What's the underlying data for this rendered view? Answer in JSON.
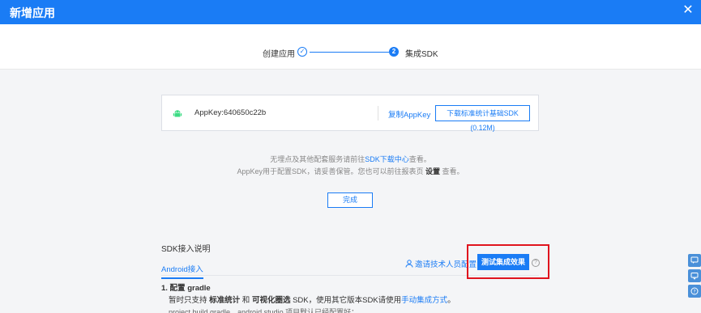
{
  "header": {
    "title": "新增应用",
    "close": "✕"
  },
  "steps": {
    "step1_label": "创建应用",
    "step1_mark": "✓",
    "step2_num": "2",
    "step2_label": "集成SDK"
  },
  "keybox": {
    "appkey": "AppKey:640650c22b",
    "copy_label": "复制AppKey",
    "download_label": "下载标准统计基础SDK (0.12M)"
  },
  "info": {
    "line1_pre": "无埋点及其他配套服务请前往",
    "line1_link": "SDK下载中心",
    "line1_post": "查看。",
    "line2_pre": "AppKey用于配置SDK，请妥善保管。您也可以前往报表页 ",
    "line2_bold": "设置",
    "line2_post": " 查看。"
  },
  "done_label": "完成",
  "sdk": {
    "title": "SDK接入说明",
    "tab_android": "Android接入",
    "invite_label": "邀请技术人员配置",
    "test_label": "测试集成效果",
    "help": "?"
  },
  "config": {
    "title": "1. 配置 gradle",
    "l1_a": "暂时只支持 ",
    "l1_b": "标准统计",
    "l1_c": " 和 ",
    "l1_d": "可视化圈选",
    "l1_e": " SDK，使用其它版本SDK请使用",
    "l1_link": "手动集成方式",
    "l1_f": "。",
    "l2": "project build.gradle，android studio 项目默认已经配置好："
  },
  "colors": {
    "primary": "#1a7cf5",
    "highlight": "#e0141e",
    "side": "#4a90d9"
  }
}
